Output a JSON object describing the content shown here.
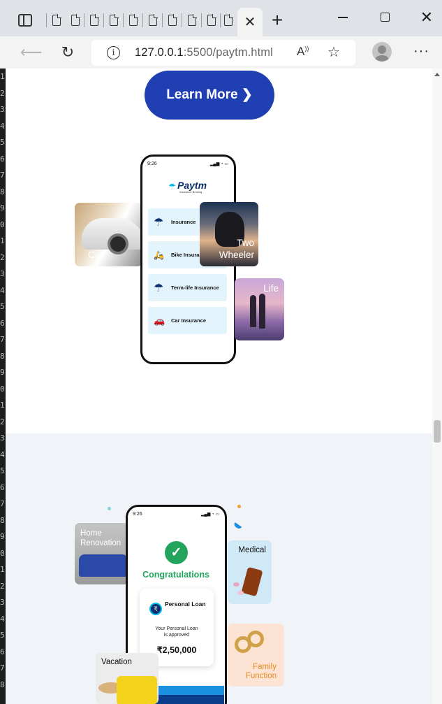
{
  "browser": {
    "url_host": "127.0.0.1",
    "url_rest": ":5500/paytm.html",
    "new_tab": "+",
    "close_tab": "✕",
    "minimize": "—",
    "close": "✕",
    "menu": "···"
  },
  "gutter_numbers": [
    "1",
    "2",
    "3",
    "4",
    "5",
    "6",
    "7",
    "8",
    "9",
    "0",
    "1",
    "2",
    "3",
    "4",
    "5",
    "6",
    "7",
    "8",
    "9",
    "0",
    "1",
    "2",
    "3",
    "4",
    "5",
    "6",
    "7",
    "8",
    "9",
    "0",
    "1",
    "2",
    "3",
    "4",
    "5",
    "6",
    "7",
    "8"
  ],
  "hero": {
    "learn_more": "Learn More ❯"
  },
  "insurance_phone": {
    "time": "9:26",
    "brand": "Paytm",
    "brand_sub": "Insurance Broking",
    "items": [
      {
        "label": "Insurance",
        "icon": "umbrella-icon"
      },
      {
        "label": "Bike Insurance",
        "icon": "bike-icon"
      },
      {
        "label": "Term-life Insurance",
        "icon": "family-umbrella-icon"
      },
      {
        "label": "Car Insurance",
        "icon": "car-icon"
      }
    ]
  },
  "insurance_tiles": {
    "car": "Car",
    "two_wheeler": "Two\nWheeler",
    "life": "Life"
  },
  "loan_phone": {
    "time": "9:26",
    "congrats": "Congratulations",
    "card_title": "Personal Loan",
    "card_message": "Your Personal Loan is approved",
    "amount": "₹2,50,000"
  },
  "loan_tiles": {
    "home_renovation": "Home\nRenovation",
    "medical": "Medical",
    "family_function": "Family\nFunction",
    "vacation": "Vacation"
  },
  "colors": {
    "brand_blue": "#1f3fb3",
    "paytm_navy": "#0b2f6a",
    "paytm_cyan": "#00b9f1",
    "success_green": "#22a45d",
    "accent_orange": "#e58a1f"
  }
}
